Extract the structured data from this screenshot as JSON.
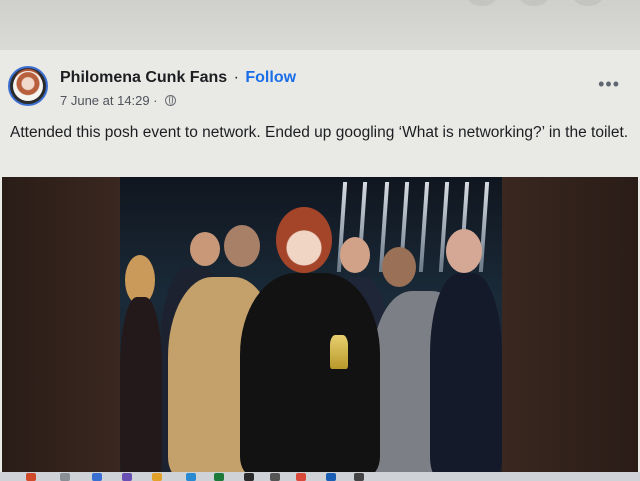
{
  "post": {
    "page_name": "Philomena Cunk Fans",
    "separator": "·",
    "follow_label": "Follow",
    "timestamp": "7 June at 14:29",
    "meta_separator": "·",
    "audience_icon": "globe-icon",
    "more_icon": "more-options-icon",
    "more_label": "•••",
    "text": "Attended this posh event to network. Ended up googling ‘What is networking?’ in the toilet."
  },
  "colors": {
    "follow_link": "#1a6ee8",
    "avatar_ring": "#3b6fd1",
    "text_primary": "#1c1e21",
    "text_secondary": "#50535a"
  }
}
